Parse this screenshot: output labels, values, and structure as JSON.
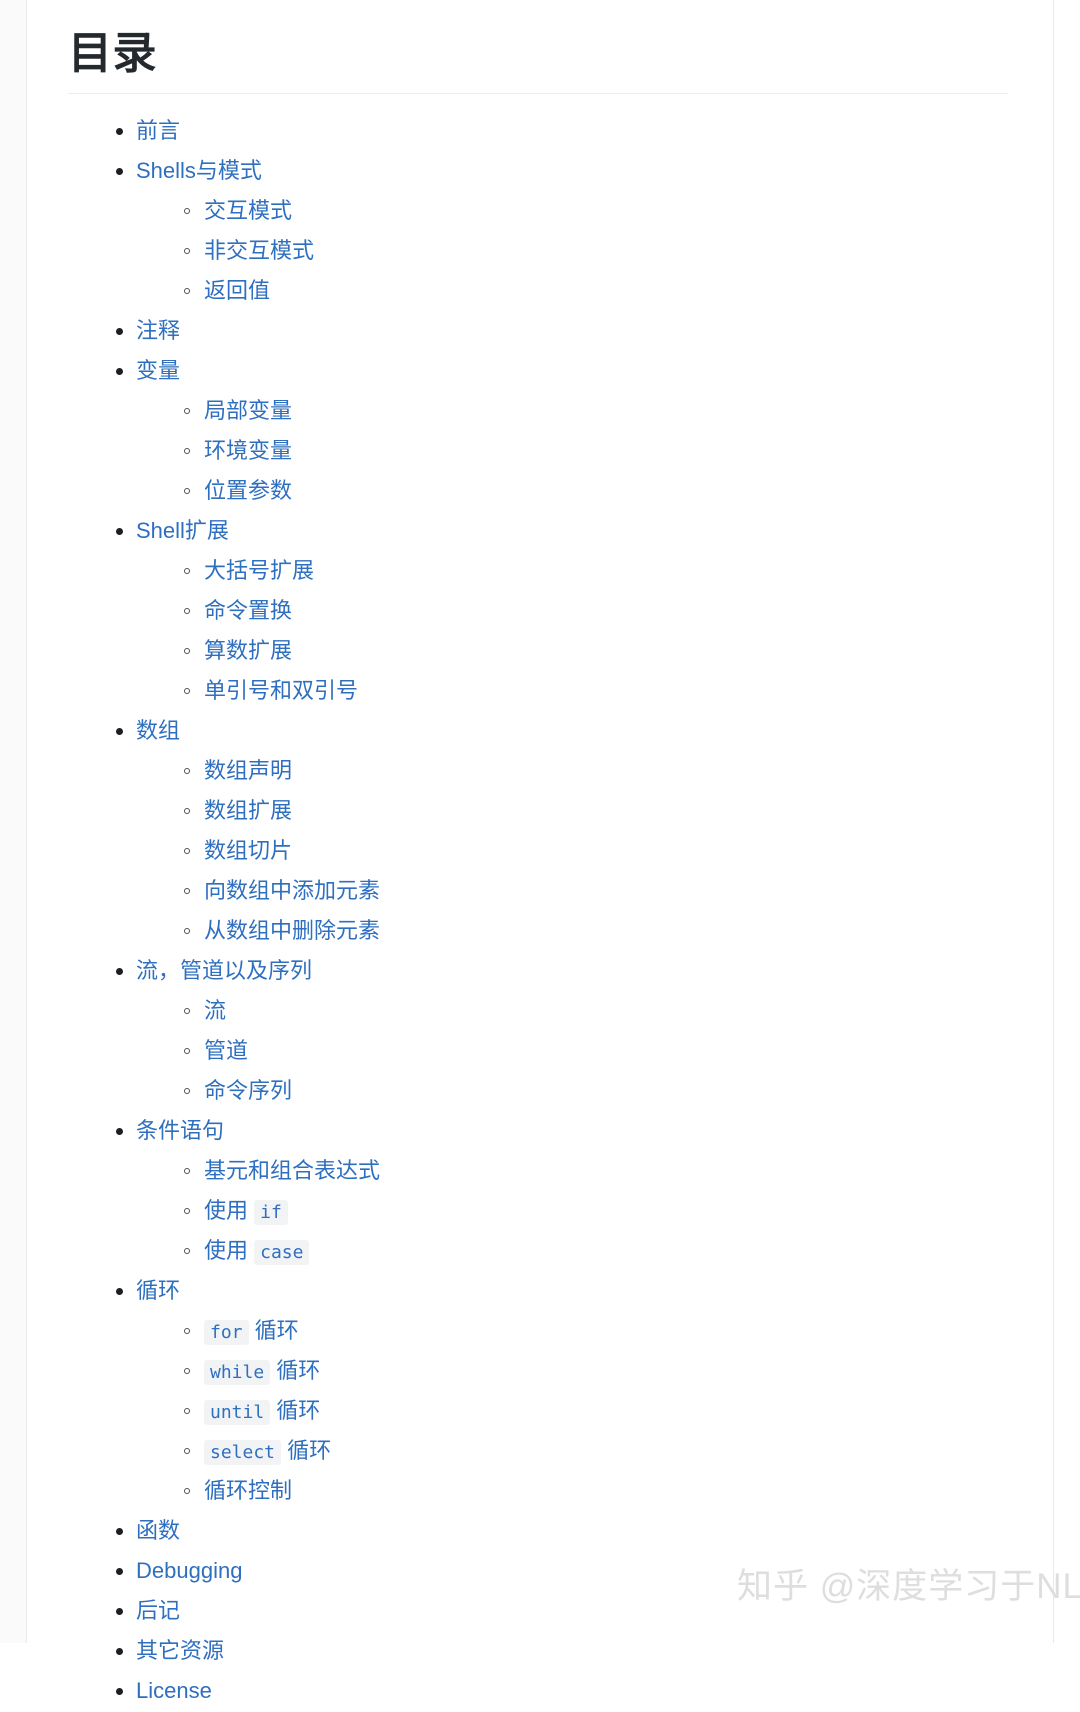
{
  "page": {
    "title": "目录",
    "link_color": "#2f6fbf",
    "title_color": "#24292e",
    "background": "#ffffff",
    "rule_color": "#eaecef"
  },
  "watermark": {
    "text": "知乎 @深度学习于NLP",
    "color": "#dedede"
  },
  "toc": [
    {
      "label": "前言",
      "children": []
    },
    {
      "label": "Shells与模式",
      "children": [
        {
          "label": "交互模式"
        },
        {
          "label": "非交互模式"
        },
        {
          "label": "返回值"
        }
      ]
    },
    {
      "label": "注释",
      "children": []
    },
    {
      "label": "变量",
      "children": [
        {
          "label": "局部变量"
        },
        {
          "label": "环境变量"
        },
        {
          "label": "位置参数"
        }
      ]
    },
    {
      "label": "Shell扩展",
      "children": [
        {
          "label": "大括号扩展"
        },
        {
          "label": "命令置换"
        },
        {
          "label": "算数扩展"
        },
        {
          "label": "单引号和双引号"
        }
      ]
    },
    {
      "label": "数组",
      "children": [
        {
          "label": "数组声明"
        },
        {
          "label": "数组扩展"
        },
        {
          "label": "数组切片"
        },
        {
          "label": "向数组中添加元素"
        },
        {
          "label": "从数组中删除元素"
        }
      ]
    },
    {
      "label": "流，管道以及序列",
      "children": [
        {
          "label": "流"
        },
        {
          "label": "管道"
        },
        {
          "label": "命令序列"
        }
      ]
    },
    {
      "label": "条件语句",
      "children": [
        {
          "label": "基元和组合表达式"
        },
        {
          "prefix": "使用 ",
          "code": "if",
          "suffix": ""
        },
        {
          "prefix": "使用 ",
          "code": "case",
          "suffix": ""
        }
      ]
    },
    {
      "label": "循环",
      "children": [
        {
          "prefix": "",
          "code": "for",
          "suffix": " 循环"
        },
        {
          "prefix": "",
          "code": "while",
          "suffix": " 循环"
        },
        {
          "prefix": "",
          "code": "until",
          "suffix": " 循环"
        },
        {
          "prefix": "",
          "code": "select",
          "suffix": " 循环"
        },
        {
          "label": "循环控制"
        }
      ]
    },
    {
      "label": "函数",
      "children": []
    },
    {
      "label": "Debugging",
      "children": []
    },
    {
      "label": "后记",
      "children": []
    },
    {
      "label": "其它资源",
      "children": []
    },
    {
      "label": "License",
      "children": []
    }
  ]
}
